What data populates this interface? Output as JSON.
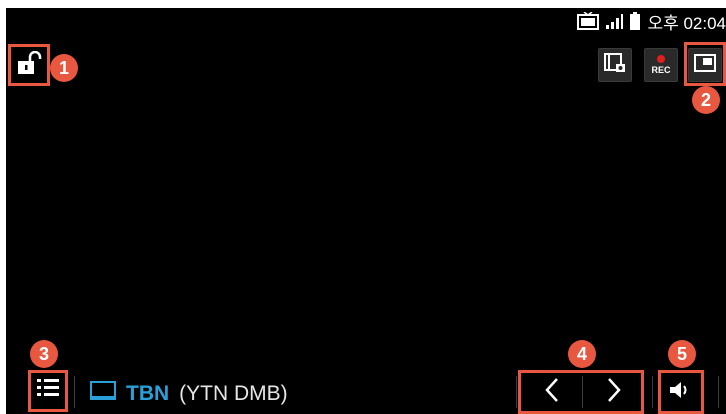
{
  "status_bar": {
    "tv_icon": "tv-icon",
    "signal_icon": "signal-icon",
    "battery_icon": "battery-icon",
    "time": "오후 02:04"
  },
  "top_controls": {
    "lock_icon": "unlock-icon",
    "capture_icon": "screen-capture-icon",
    "record_label": "REC",
    "pip_icon": "pip-icon"
  },
  "bottom_bar": {
    "channel_list_icon": "list-icon",
    "channel_type_icon": "tv-icon",
    "channel_name": "TBN",
    "channel_sub": "(YTN DMB)",
    "prev_icon": "chevron-left-icon",
    "next_icon": "chevron-right-icon",
    "volume_icon": "volume-icon"
  },
  "callouts": [
    "1",
    "2",
    "3",
    "4",
    "5"
  ],
  "colors": {
    "screen_bg": "#000000",
    "highlight": "#e8573f",
    "channel_name": "#2aa0d8",
    "rec_dot": "#e02020"
  }
}
